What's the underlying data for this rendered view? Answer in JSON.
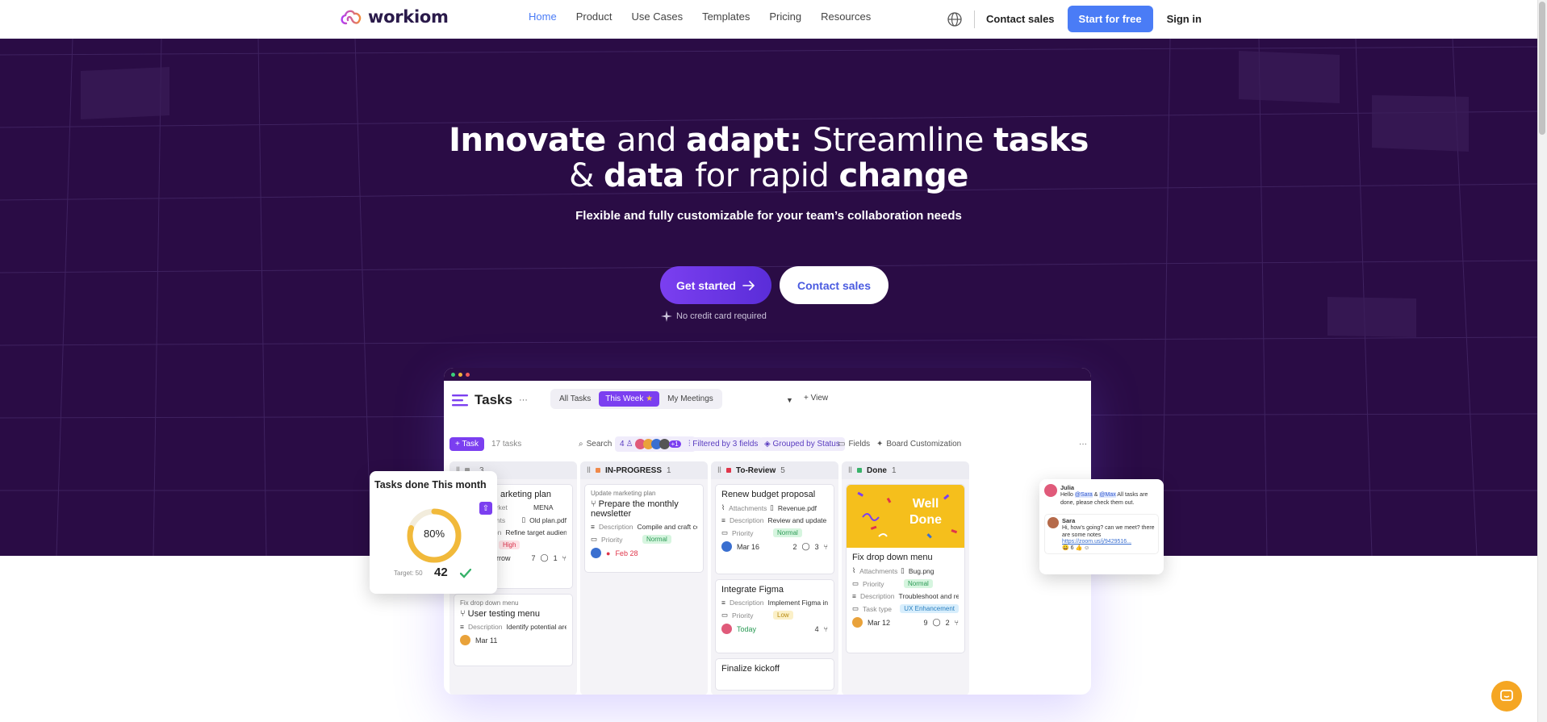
{
  "brand": {
    "name": "workiom",
    "accent": "#4a7cf6",
    "hero_bg": "#2a0c45",
    "primary": "#7b3ff0"
  },
  "nav": {
    "items": [
      {
        "label": "Home"
      },
      {
        "label": "Product"
      },
      {
        "label": "Use Cases"
      },
      {
        "label": "Templates"
      },
      {
        "label": "Pricing"
      },
      {
        "label": "Resources"
      }
    ],
    "active": "Home",
    "contact_sales": "Contact sales",
    "start_free": "Start for free",
    "sign_in": "Sign in",
    "globe_icon": "globe-icon"
  },
  "hero": {
    "line1": [
      {
        "t": "Innovate ",
        "bold": true
      },
      {
        "t": "and ",
        "bold": false
      },
      {
        "t": "adapt: ",
        "bold": true
      },
      {
        "t": "Streamline ",
        "bold": false
      },
      {
        "t": "tasks",
        "bold": true
      }
    ],
    "line2": [
      {
        "t": "& ",
        "bold": false
      },
      {
        "t": "data ",
        "bold": true
      },
      {
        "t": "for rapid ",
        "bold": false
      },
      {
        "t": "change",
        "bold": true
      }
    ],
    "subtitle": "Flexible and fully customizable for your team’s collaboration needs",
    "get_started": "Get started",
    "contact_sales": "Contact sales",
    "no_card": "No credit card required"
  },
  "app": {
    "title": "Tasks",
    "views": [
      "All Tasks",
      "This Week",
      "My Meetings"
    ],
    "add_view": "+ View",
    "toolbar": {
      "add_task": "+ Task",
      "task_count": "17 tasks",
      "search": "Search",
      "people_count": "4",
      "more_people": "+1",
      "filter": "Filtered by 3 fields",
      "group": "Grouped by Status",
      "fields": "Fields",
      "board": "Board Customization"
    },
    "columns": [
      {
        "name": "",
        "count": "3",
        "color": "#9b9b9b",
        "cards": [
          {
            "title": "arketing plan",
            "rows": [
              [
                "arket",
                "MENA"
              ],
              [
                "ents",
                "Old plan.pdf"
              ],
              [
                "ion",
                "Refine target audience..."
              ]
            ],
            "tag": "High",
            "date": "orrow",
            "comments": "7",
            "subtasks": "1"
          },
          {
            "parent": "Fix drop down menu",
            "title": "User testing menu",
            "rows": [
              [
                "Description",
                "Identify potential area..."
              ]
            ],
            "date": "Mar 11"
          }
        ]
      },
      {
        "name": "IN-PROGRESS",
        "count": "1",
        "color": "#f0894a",
        "cards": [
          {
            "parent": "Update marketing plan",
            "title": "Prepare the monthly newsletter",
            "rows": [
              [
                "Description",
                "Compile and craft cont..."
              ]
            ],
            "priority": "Normal",
            "date": "Feb 28"
          }
        ]
      },
      {
        "name": "To-Review",
        "count": "5",
        "color": "#e0354a",
        "cards": [
          {
            "title": "Renew budget proposal",
            "rows": [
              [
                "Attachments",
                "Revenue.pdf"
              ],
              [
                "Description",
                "Review and update the..."
              ]
            ],
            "priority": "Normal",
            "date": "Mar 16",
            "comments": "2",
            "subtasks": "3"
          },
          {
            "title": "Integrate Figma",
            "rows": [
              [
                "Description",
                "Implement Figma inte..."
              ]
            ],
            "priority": "Low",
            "date": "Today",
            "subtasks": "4"
          },
          {
            "title": "Finalize kickoff"
          }
        ]
      },
      {
        "name": "Done",
        "count": "1",
        "color": "#38b26a",
        "cards": [
          {
            "banner": "Well Done",
            "title": "Fix drop down menu",
            "rows": [
              [
                "Attachments",
                "Bug.png"
              ]
            ],
            "priority": "Normal",
            "desc": "Troubleshoot and resol...",
            "task_type": "UX Enhancement",
            "date": "Mar 12",
            "comments": "9",
            "subtasks": "2"
          }
        ]
      }
    ],
    "labels": {
      "priority": "Priority",
      "description": "Description",
      "attachments": "Attachments",
      "task_type": "Task type"
    }
  },
  "widget": {
    "title": "Tasks done This month",
    "percent": "80%",
    "progress": 0.8,
    "target_label": "Target: 50",
    "value": "42"
  },
  "chat": {
    "user1": "Julia",
    "msg1_a": "Hello",
    "msg1_m1": "@Sara",
    "msg1_amp": "&",
    "msg1_m2": "@Max",
    "msg1_b": "All tasks are done, please check them out.",
    "user2": "Sara",
    "msg2": "Hi, how's going? can we meet? there are some notes",
    "link": "https://zoom.us/j/9429516...",
    "reactions": "6"
  }
}
